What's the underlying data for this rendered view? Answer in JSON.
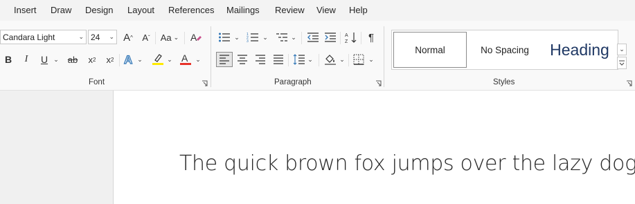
{
  "menu": {
    "items": [
      "Insert",
      "Draw",
      "Design",
      "Layout",
      "References",
      "Mailings",
      "Review",
      "View",
      "Help"
    ]
  },
  "font_group": {
    "font_name": "Candara Light",
    "font_size": "24",
    "change_case_label": "Aa",
    "label": "Font"
  },
  "paragraph_group": {
    "label": "Paragraph"
  },
  "styles_group": {
    "label": "Styles",
    "normal": "Normal",
    "no_spacing": "No Spacing",
    "heading": "Heading"
  },
  "document": {
    "text": "The quick brown fox jumps over the lazy dog."
  },
  "colors": {
    "highlight": "#ffea00",
    "font_color": "#e8332a",
    "heading_style": "#1f3864",
    "text_effects": "#2e74b5"
  }
}
